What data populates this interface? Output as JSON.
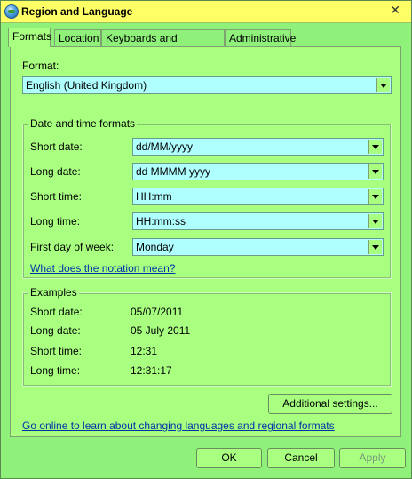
{
  "window": {
    "title": "Region and Language",
    "close_glyph": "✕"
  },
  "tabs": [
    {
      "label": "Formats"
    },
    {
      "label": "Location"
    },
    {
      "label": "Keyboards and Languages"
    },
    {
      "label": "Administrative"
    }
  ],
  "format": {
    "label": "Format:",
    "value": "English (United Kingdom)"
  },
  "datetime": {
    "group_title": "Date and time formats",
    "rows": [
      {
        "label": "Short date:",
        "value": "dd/MM/yyyy"
      },
      {
        "label": "Long date:",
        "value": "dd MMMM yyyy"
      },
      {
        "label": "Short time:",
        "value": "HH:mm"
      },
      {
        "label": "Long time:",
        "value": "HH:mm:ss"
      },
      {
        "label": "First day of week:",
        "value": "Monday"
      }
    ],
    "notation_link": "What does the notation mean?"
  },
  "examples": {
    "group_title": "Examples",
    "rows": [
      {
        "label": "Short date:",
        "value": "05/07/2011"
      },
      {
        "label": "Long date:",
        "value": "05 July 2011"
      },
      {
        "label": "Short time:",
        "value": "12:31"
      },
      {
        "label": "Long time:",
        "value": "12:31:17"
      }
    ]
  },
  "additional_settings_label": "Additional settings...",
  "online_link": "Go online to learn about changing languages and regional formats",
  "buttons": {
    "ok": "OK",
    "cancel": "Cancel",
    "apply": "Apply"
  }
}
